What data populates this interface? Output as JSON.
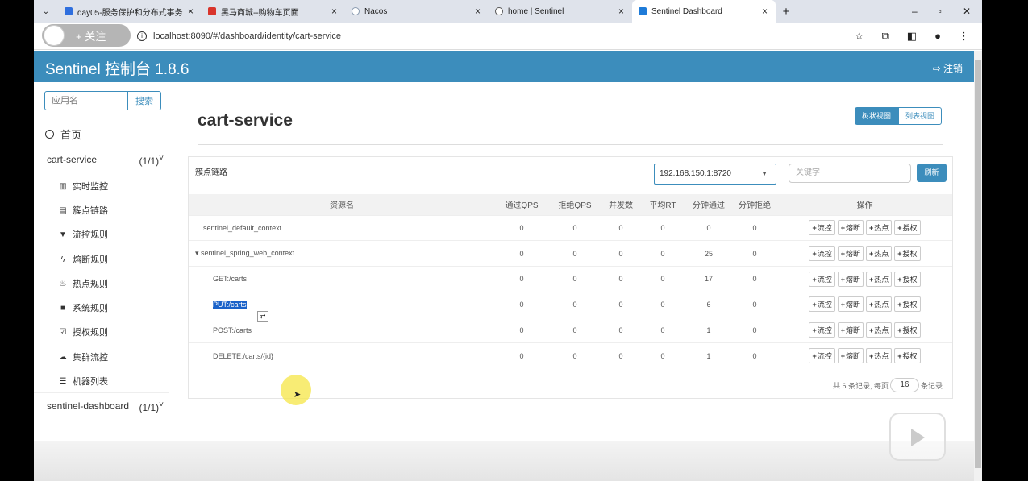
{
  "browser": {
    "tabs": [
      {
        "title": "day05-服务保护和分布式事务",
        "icon_color": "#2f6fde"
      },
      {
        "title": "黑马商城--购物车页面",
        "icon_color": "#d9342b"
      },
      {
        "title": "Nacos",
        "icon_color": "#8a9bb0"
      },
      {
        "title": "home | Sentinel",
        "icon_color": "#555555"
      },
      {
        "title": "Sentinel Dashboard",
        "icon_color": "#1e7bd8"
      }
    ],
    "overlay_follow": "+ 关注",
    "url": "localhost:8090/#/dashboard/identity/cart-service"
  },
  "header": {
    "brand": "Sentinel 控制台 1.8.6",
    "logout": "注销",
    "color": "#3c8dbc"
  },
  "sidebar": {
    "search_placeholder": "应用名",
    "search_button": "搜索",
    "home": "首页",
    "apps": [
      {
        "name": "cart-service",
        "count": "(1/1)"
      },
      {
        "name": "sentinel-dashboard",
        "count": "(1/1)"
      }
    ],
    "menu": [
      {
        "label": "实时监控",
        "icon": "bar-chart-icon"
      },
      {
        "label": "簇点链路",
        "icon": "list-icon"
      },
      {
        "label": "流控规则",
        "icon": "filter-icon"
      },
      {
        "label": "熔断规则",
        "icon": "bolt-icon"
      },
      {
        "label": "热点规则",
        "icon": "fire-icon"
      },
      {
        "label": "系统规则",
        "icon": "lock-icon"
      },
      {
        "label": "授权规则",
        "icon": "check-icon"
      },
      {
        "label": "集群流控",
        "icon": "cloud-icon"
      },
      {
        "label": "机器列表",
        "icon": "server-list-icon"
      }
    ]
  },
  "main": {
    "title": "cart-service",
    "view_tree": "树状视图",
    "view_list": "列表视图",
    "panel_title": "簇点链路",
    "machine": "192.168.150.1:8720",
    "keyword_placeholder": "关键字",
    "refresh": "刷新",
    "columns": [
      "资源名",
      "通过QPS",
      "拒绝QPS",
      "并发数",
      "平均RT",
      "分钟通过",
      "分钟拒绝",
      "操作"
    ],
    "rows": [
      {
        "resource": "sentinel_default_context",
        "pass_qps": "0",
        "block_qps": "0",
        "concurrency": "0",
        "avg_rt": "0",
        "minute_pass": "0",
        "minute_block": "0"
      },
      {
        "resource": "sentinel_spring_web_context",
        "pass_qps": "0",
        "block_qps": "0",
        "concurrency": "0",
        "avg_rt": "0",
        "minute_pass": "25",
        "minute_block": "0"
      },
      {
        "resource": "GET:/carts",
        "pass_qps": "0",
        "block_qps": "0",
        "concurrency": "0",
        "avg_rt": "0",
        "minute_pass": "17",
        "minute_block": "0"
      },
      {
        "resource": "PUT:/carts",
        "pass_qps": "0",
        "block_qps": "0",
        "concurrency": "0",
        "avg_rt": "0",
        "minute_pass": "6",
        "minute_block": "0"
      },
      {
        "resource": "POST:/carts",
        "pass_qps": "0",
        "block_qps": "0",
        "concurrency": "0",
        "avg_rt": "0",
        "minute_pass": "1",
        "minute_block": "0"
      },
      {
        "resource": "DELETE:/carts/{id}",
        "pass_qps": "0",
        "block_qps": "0",
        "concurrency": "0",
        "avg_rt": "0",
        "minute_pass": "1",
        "minute_block": "0"
      }
    ],
    "actions": [
      "流控",
      "熔断",
      "热点",
      "授权"
    ],
    "pager_prefix": "共 6 条记录, 每页",
    "page_size": "16",
    "pager_suffix": "条记录"
  }
}
